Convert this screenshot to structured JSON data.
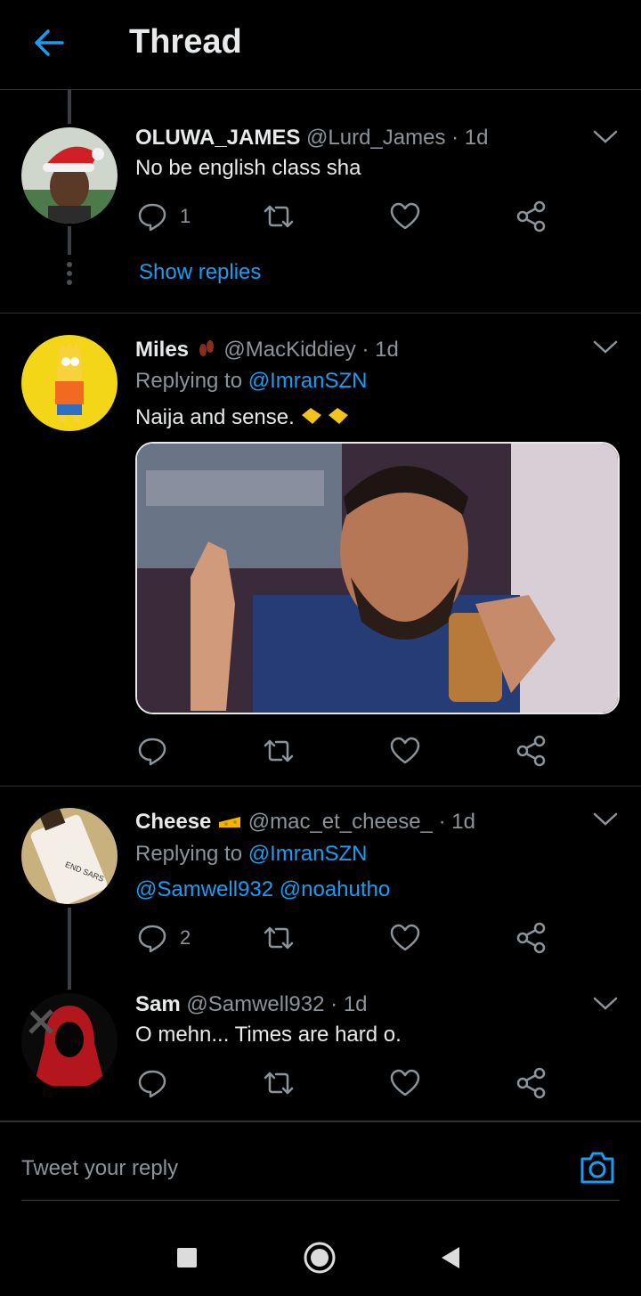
{
  "header": {
    "title": "Thread",
    "back_icon": "arrow-left-icon"
  },
  "tweets": [
    {
      "display_name": "OLUWA_JAMES",
      "handle": "@Lurd_James",
      "time": "· 1d",
      "text": "No be english class sha",
      "reply_count": "1",
      "show_replies": "Show replies"
    },
    {
      "display_name": "Miles",
      "handle": "@MacKiddiey",
      "time": "· 1d",
      "replying_prefix": "Replying to",
      "replying_to": "@ImranSZN",
      "text": "Naija and sense.",
      "name_emoji": "footprints",
      "text_emoji": "handshake"
    },
    {
      "display_name": "Cheese",
      "handle": "@mac_et_cheese_",
      "time": "· 1d",
      "replying_prefix": "Replying to",
      "replying_to": "@ImranSZN",
      "text": "@Samwell932 @noahutho",
      "reply_count": "2",
      "name_emoji": "cheese",
      "avatar_label": "END SARS"
    },
    {
      "display_name": "Sam",
      "handle": "@Samwell932",
      "time": "· 1d",
      "text": "O mehn... Times are hard o."
    }
  ],
  "composer": {
    "placeholder": "Tweet your reply",
    "camera_icon": "camera-icon"
  },
  "colors": {
    "accent": "#1d9bf0",
    "background": "#000000",
    "secondary_text": "#8b949b"
  }
}
